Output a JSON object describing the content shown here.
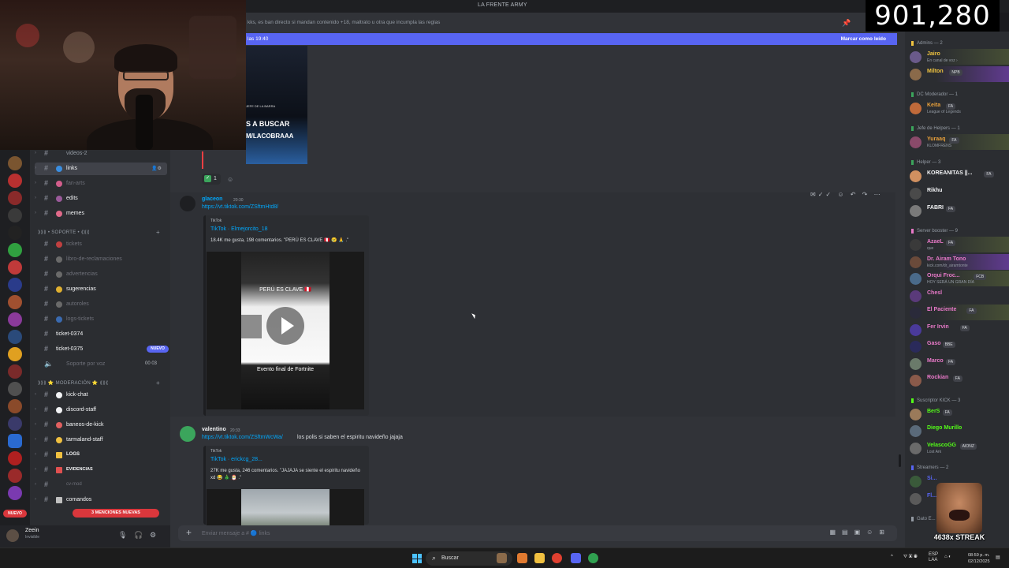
{
  "window": {
    "title": "LA FRENTE ARMY"
  },
  "overlay": {
    "counter": "901,280",
    "streak": "4638x STREAK"
  },
  "channel_header": {
    "topic": "kks, es ban directo si mandan contenido +18, maltrato u otra que incumpla las reglas"
  },
  "new_messages_bar": {
    "since": "las 19:40",
    "mark_read": "Marcar como leído"
  },
  "channels": [
    {
      "label": "videos-2",
      "state": "normal"
    },
    {
      "label": "links",
      "state": "selected"
    },
    {
      "label": "fan-arts",
      "state": "dim"
    },
    {
      "label": "edits",
      "state": "bright"
    },
    {
      "label": "memes",
      "state": "bright"
    }
  ],
  "category_soporte": "⟫⟫⟫ • SOPORTE • ⟪⟪⟪",
  "soporte_channels": [
    {
      "label": "tickets",
      "state": "dim"
    },
    {
      "label": "libro-de-reclamaciones",
      "state": "dim"
    },
    {
      "label": "advertencias",
      "state": "dim"
    },
    {
      "label": "sugerencias",
      "state": "bright"
    },
    {
      "label": "autoroles",
      "state": "dim"
    },
    {
      "label": "logs-tickets",
      "state": "dim"
    },
    {
      "label": "ticket-0374",
      "state": "bright"
    },
    {
      "label": "ticket-0375",
      "state": "bright",
      "badge": "NUEVO"
    },
    {
      "label": "Soporte por voz",
      "state": "dim",
      "voice_counts": "00  03"
    }
  ],
  "category_moderacion": "⟫⟫⟫ ⭐ MODERACIÓN ⭐ ⟪⟪⟪",
  "moderacion_channels": [
    {
      "label": "kick-chat",
      "state": "bright"
    },
    {
      "label": "discord-staff",
      "state": "bright"
    },
    {
      "label": "baneos-de-kick",
      "state": "bright"
    },
    {
      "label": "tarmaland-staff",
      "state": "bright"
    },
    {
      "label": "LOGS",
      "state": "bright"
    },
    {
      "label": "EVIDENCIAS",
      "state": "bright"
    },
    {
      "label": "cv-mod",
      "state": "dim"
    },
    {
      "label": "comandos",
      "state": "bright"
    }
  ],
  "mentions_badge": "3 MENCIONES NUEVAS",
  "rail": {
    "new_badge": "NUEVO"
  },
  "user_panel": {
    "name": "Zeein",
    "status": "Invisible"
  },
  "messages": [
    {
      "author": "glaceon",
      "time": "20:30",
      "link": "https://vt.tiktok.com/ZSftmHtd8/",
      "text": "",
      "embed": {
        "provider": "TikTok",
        "title": "TikTok · Elmejorcito_18",
        "description": "18.4K me gusta, 198 comentarios. \"PERÚ ES CLAVE 🇵🇪 😢 🙏 .\""
      },
      "video": {
        "caption_top": "PERÚ ES CLAVE 🇵🇪",
        "caption_bottom": "Evento final de Fortnite"
      }
    },
    {
      "author": "valentino",
      "time": "20:33",
      "link": "https://vt.tiktok.com/ZSftmWcWa/",
      "text": "los polis si saben el espiritu navideño jajaja",
      "embed": {
        "provider": "TikTok",
        "title": "TikTok · erickcg_28...",
        "description": "27K me gusta, 246 comentarios. \"JAJAJA se siente el espiritu navideño xd 😂 🎄 🎅 .\""
      }
    }
  ],
  "previous_post": {
    "caption_small": "JEFE DE LA BARRA",
    "caption_main": "S A BUSCAR",
    "caption_handle": "M/LACOBRAAA",
    "reaction_count": "1"
  },
  "composer": {
    "placeholder": "Enviar mensaje a # 🔵 links"
  },
  "members": {
    "groups": [
      {
        "title": "Admins — 2",
        "members": [
          {
            "name": "Jairo",
            "sub": "En canal de voz ›",
            "color": "#f0c440"
          },
          {
            "name": "Milton",
            "tag": "NPB",
            "color": "#f0c440"
          }
        ]
      },
      {
        "title": "DC Moderador — 1",
        "members": [
          {
            "name": "Keita",
            "tag": "FA",
            "sub": "League of Legends",
            "color": "#e8a03a"
          }
        ]
      },
      {
        "title": "Jefe de Helpers — 1",
        "members": [
          {
            "name": "Yuraaq",
            "tag": "FA",
            "sub": "KLOMFRENS",
            "color": "#e8a03a"
          }
        ]
      },
      {
        "title": "Helper — 3",
        "members": [
          {
            "name": "KOREANITAS ||...",
            "tag": "FA",
            "color": "#f2f3f5"
          },
          {
            "name": "Rikhu",
            "color": "#f2f3f5"
          },
          {
            "name": "FABRI",
            "tag": "FA",
            "color": "#f2f3f5"
          }
        ]
      },
      {
        "title": "Server booster — 9",
        "members": [
          {
            "name": "AzaeL",
            "tag": "FA",
            "sub": "que",
            "color": "#e879c8"
          },
          {
            "name": "Dr. Airam Tono",
            "sub": "kick.com/dr_airamtonte",
            "color": "#e879c8"
          },
          {
            "name": "Orqui Froc...",
            "tag": "FCB",
            "sub": "HOY SERÁ UN GRAN DÍA",
            "color": "#e879c8"
          },
          {
            "name": "Chesl",
            "color": "#e879c8"
          },
          {
            "name": "El Paciente",
            "tag": "FA",
            "color": "#e879c8"
          },
          {
            "name": "Fer Irvin",
            "tag": "FA",
            "color": "#e879c8"
          },
          {
            "name": "Gaso",
            "tag": "BBE",
            "color": "#e879c8"
          },
          {
            "name": "Marco",
            "tag": "FA",
            "color": "#e879c8"
          },
          {
            "name": "Rockian",
            "tag": "FA",
            "color": "#e879c8"
          }
        ]
      },
      {
        "title": "Suscriptor KICK — 3",
        "members": [
          {
            "name": "BerS",
            "tag": "FA",
            "color": "#53fc18"
          },
          {
            "name": "Diego Murillo",
            "color": "#53fc18"
          },
          {
            "name": "VelascoGG",
            "tag": "AIONZ",
            "sub": "Lost Ark",
            "color": "#53fc18"
          }
        ]
      },
      {
        "title": "Streamers — 2",
        "members": [
          {
            "name": "Si...",
            "color": "#5865f2"
          },
          {
            "name": "Fl...",
            "color": "#5865f2"
          }
        ]
      },
      {
        "title": "Gato E...",
        "members": []
      }
    ]
  },
  "taskbar": {
    "search": "Buscar",
    "lang": "ESP\nLAA",
    "time": "08:59 p. m.",
    "date": "02/12/2025"
  },
  "colors": {
    "blurple": "#5865f2",
    "link": "#00a8fc",
    "danger": "#da373c",
    "bg_chat": "#313338",
    "bg_side": "#2b2d31"
  }
}
